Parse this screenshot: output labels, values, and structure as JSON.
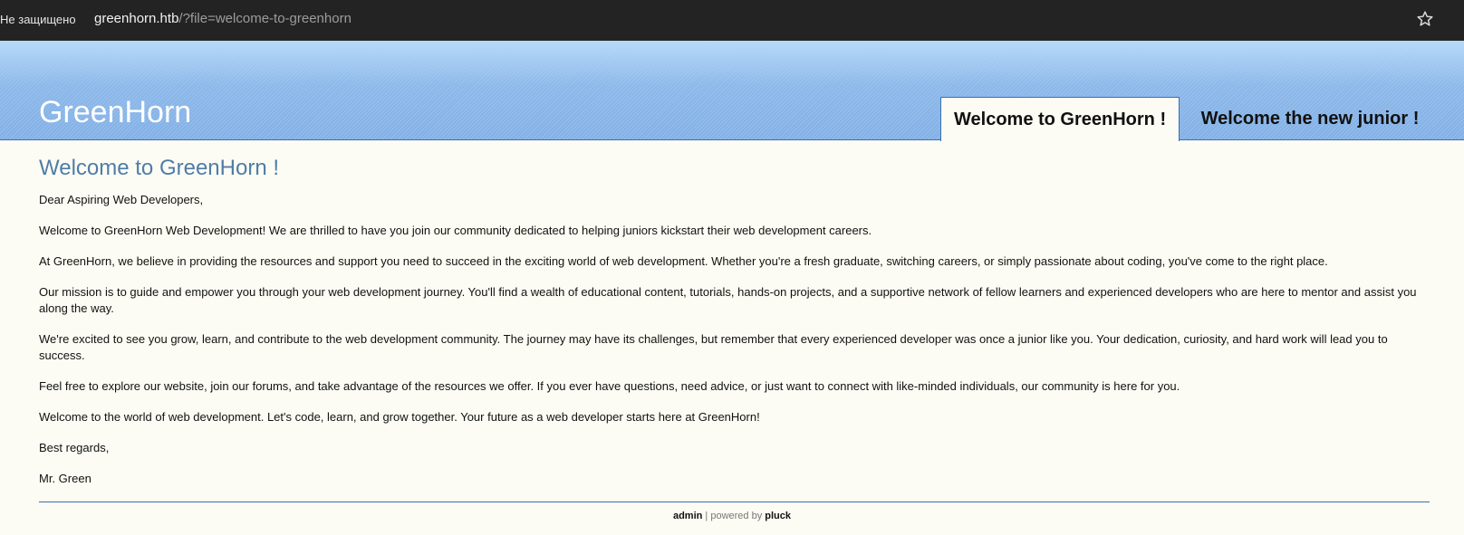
{
  "browser": {
    "security_label": "Не защищено",
    "url_host": "greenhorn.htb",
    "url_path": "/?file=welcome-to-greenhorn",
    "bookmark_icon": "star-icon"
  },
  "header": {
    "site_title": "GreenHorn",
    "tabs": [
      {
        "label": "Welcome to GreenHorn !",
        "active": true
      },
      {
        "label": "Welcome the new junior !",
        "active": false
      }
    ]
  },
  "main": {
    "heading": "Welcome to GreenHorn !",
    "paragraphs": [
      "Dear Aspiring Web Developers,",
      "Welcome to GreenHorn Web Development! We are thrilled to have you join our community dedicated to helping juniors kickstart their web development careers.",
      "At GreenHorn, we believe in providing the resources and support you need to succeed in the exciting world of web development. Whether you're a fresh graduate, switching careers, or simply passionate about coding, you've come to the right place.",
      "Our mission is to guide and empower you through your web development journey. You'll find a wealth of educational content, tutorials, hands-on projects, and a supportive network of fellow learners and experienced developers who are here to mentor and assist you along the way.",
      "We're excited to see you grow, learn, and contribute to the web development community. The journey may have its challenges, but remember that every experienced developer was once a junior like you. Your dedication, curiosity, and hard work will lead you to success.",
      "Feel free to explore our website, join our forums, and take advantage of the resources we offer. If you ever have questions, need advice, or just want to connect with like-minded individuals, our community is here for you.",
      "Welcome to the world of web development. Let's code, learn, and grow together. Your future as a web developer starts here at GreenHorn!",
      "Best regards,",
      "Mr. Green"
    ]
  },
  "footer": {
    "admin_link": "admin",
    "separator": " | powered by ",
    "pluck_link": "pluck"
  },
  "colors": {
    "heading": "#4f7da8",
    "header_blue": "#82b0e6",
    "border_blue": "#3a6fb3",
    "page_bg": "#fcfcf4"
  }
}
